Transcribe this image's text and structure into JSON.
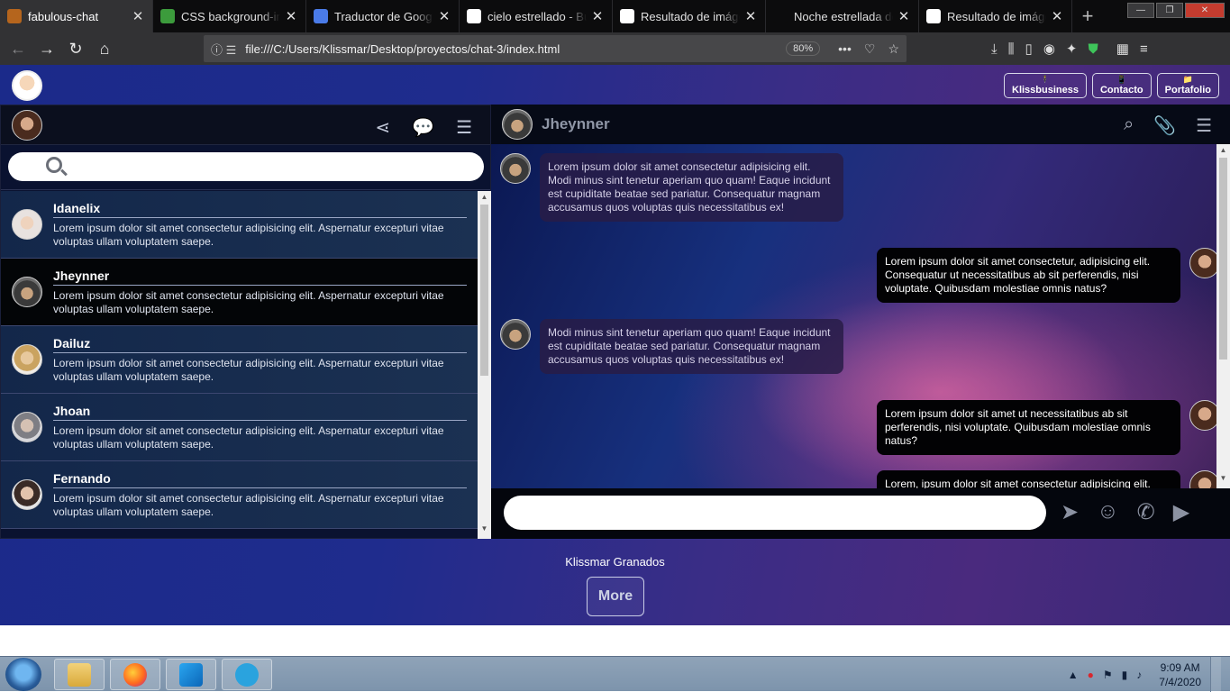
{
  "browser": {
    "tabs": [
      {
        "title": "fabulous-chat",
        "active": true,
        "favicon_color": "#b5651d"
      },
      {
        "title": "CSS background-ima",
        "active": false,
        "favicon_color": "#3c9b3c"
      },
      {
        "title": "Traductor de Google",
        "active": false,
        "favicon_color": "#4a7be8"
      },
      {
        "title": "cielo estrellado - Bús",
        "active": false,
        "favicon_color": "#ffffff"
      },
      {
        "title": "Resultado de imágen",
        "active": false,
        "favicon_color": "#ffffff"
      },
      {
        "title": "Noche estrellada del",
        "active": false,
        "favicon_color": "#0c0c0d"
      },
      {
        "title": "Resultado de imágen",
        "active": false,
        "favicon_color": "#ffffff"
      }
    ],
    "url": "file:///C:/Users/Klissmar/Desktop/proyectos/chat-3/index.html",
    "zoom": "80%"
  },
  "header": {
    "buttons": [
      {
        "icon": "🕴",
        "label": "Klissbusiness"
      },
      {
        "icon": "📱",
        "label": "Contacto"
      },
      {
        "icon": "📁",
        "label": "Portafolio"
      }
    ]
  },
  "contacts": [
    {
      "name": "Idanelix",
      "message": "Lorem ipsum dolor sit amet consectetur adipisicing elit. Aspernatur excepturi vitae voluptas ullam voluptatem saepe.",
      "avatar": "av-a"
    },
    {
      "name": "Jheynner",
      "message": "Lorem ipsum dolor sit amet consectetur adipisicing elit. Aspernatur excepturi vitae voluptas ullam voluptatem saepe.",
      "avatar": "av-man",
      "selected": true
    },
    {
      "name": "Dailuz",
      "message": "Lorem ipsum dolor sit amet consectetur adipisicing elit. Aspernatur excepturi vitae voluptas ullam voluptatem saepe.",
      "avatar": "av-b"
    },
    {
      "name": "Jhoan",
      "message": "Lorem ipsum dolor sit amet consectetur adipisicing elit. Aspernatur excepturi vitae voluptas ullam voluptatem saepe.",
      "avatar": "av-c"
    },
    {
      "name": "Fernando",
      "message": "Lorem ipsum dolor sit amet consectetur adipisicing elit. Aspernatur excepturi vitae voluptas ullam voluptatem saepe.",
      "avatar": "av-d"
    }
  ],
  "chat": {
    "contact_name": "Jheynner",
    "messages": [
      {
        "direction": "in",
        "text": "Lorem ipsum dolor sit amet consectetur adipisicing elit. Modi minus sint tenetur aperiam quo quam! Eaque incidunt est cupiditate beatae sed pariatur. Consequatur magnam accusamus quos voluptas quis necessitatibus ex!"
      },
      {
        "direction": "out",
        "text": "Lorem ipsum dolor sit amet consectetur, adipisicing elit. Consequatur ut necessitatibus ab sit perferendis, nisi voluptate. Quibusdam molestiae omnis natus?"
      },
      {
        "direction": "in",
        "text": "Modi minus sint tenetur aperiam quo quam! Eaque incidunt est cupiditate beatae sed pariatur. Consequatur magnam accusamus quos voluptas quis necessitatibus ex!"
      },
      {
        "direction": "out",
        "text": "Lorem ipsum dolor sit amet ut necessitatibus ab sit perferendis, nisi voluptate. Quibusdam molestiae omnis natus?"
      },
      {
        "direction": "out",
        "text": "Lorem, ipsum dolor sit amet consectetur adipisicing elit."
      }
    ],
    "input_value": ""
  },
  "footer": {
    "name": "Klissmar Granados",
    "more_label": "More"
  },
  "taskbar": {
    "time": "9:09 AM",
    "date": "7/4/2020"
  }
}
